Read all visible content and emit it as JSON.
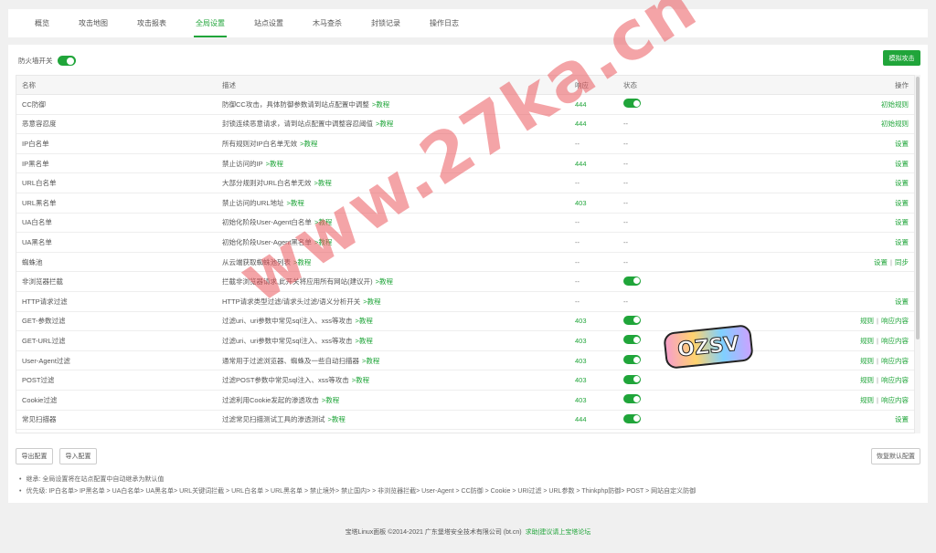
{
  "tabs": [
    "概览",
    "攻击地图",
    "攻击报表",
    "全局设置",
    "站点设置",
    "木马查杀",
    "封锁记录",
    "操作日志"
  ],
  "active_tab_index": 3,
  "firewall_switch": {
    "label": "防火墙开关",
    "on": true
  },
  "simulate_button": "模拟攻击",
  "table": {
    "headers": {
      "name": "名称",
      "desc": "描述",
      "resp": "响应",
      "status": "状态",
      "ops": "操作"
    },
    "rows": [
      {
        "name": "CC防御",
        "desc": "防御CC攻击，具体防御参数请到站点配置中调整",
        "tut": ">教程",
        "resp": "444",
        "status": "on",
        "ops": [
          "初始规则"
        ]
      },
      {
        "name": "恶意容忍度",
        "desc": "封锁连续恶意请求，请到站点配置中调整容忍阈值",
        "tut": ">教程",
        "resp": "444",
        "status": "--",
        "ops": [
          "初始规则"
        ]
      },
      {
        "name": "IP白名单",
        "desc": "所有规则对IP白名单无效",
        "tut": ">教程",
        "resp": "--",
        "status": "--",
        "ops": [
          "设置"
        ]
      },
      {
        "name": "IP黑名单",
        "desc": "禁止访问的IP",
        "tut": ">教程",
        "resp": "444",
        "status": "--",
        "ops": [
          "设置"
        ]
      },
      {
        "name": "URL白名单",
        "desc": "大部分规则对URL白名单无效",
        "tut": ">教程",
        "resp": "--",
        "status": "--",
        "ops": [
          "设置"
        ]
      },
      {
        "name": "URL黑名单",
        "desc": "禁止访问的URL地址",
        "tut": ">教程",
        "resp": "403",
        "status": "--",
        "ops": [
          "设置"
        ]
      },
      {
        "name": "UA白名单",
        "desc": "初始化阶段User-Agent白名单",
        "tut": ">教程",
        "resp": "--",
        "status": "--",
        "ops": [
          "设置"
        ]
      },
      {
        "name": "UA黑名单",
        "desc": "初始化阶段User-Agent黑名单",
        "tut": ">教程",
        "resp": "--",
        "status": "--",
        "ops": [
          "设置"
        ]
      },
      {
        "name": "蜘蛛池",
        "desc": "从云端获取蜘蛛池列表",
        "tut": ">教程",
        "resp": "--",
        "status": "--",
        "ops": [
          "设置",
          "同步"
        ]
      },
      {
        "name": "非浏览器拦截",
        "desc": "拦截非浏览器请求,此开关将应用所有网站(建议开)",
        "tut": ">教程",
        "resp": "--",
        "status": "on",
        "ops": []
      },
      {
        "name": "HTTP请求过滤",
        "desc": "HTTP请求类型过滤/请求头过滤/语义分析开关",
        "tut": ">教程",
        "resp": "--",
        "status": "--",
        "ops": [
          "设置"
        ]
      },
      {
        "name": "GET-参数过滤",
        "desc": "过滤uri、uri参数中常见sql注入、xss等攻击",
        "tut": ">教程",
        "resp": "403",
        "status": "on",
        "ops": [
          "规则",
          "响应内容"
        ]
      },
      {
        "name": "GET-URL过滤",
        "desc": "过滤uri、uri参数中常见sql注入、xss等攻击",
        "tut": ">教程",
        "resp": "403",
        "status": "on",
        "ops": [
          "规则",
          "响应内容"
        ]
      },
      {
        "name": "User-Agent过滤",
        "desc": "通常用于过滤浏览器、蜘蛛及一些自动扫描器",
        "tut": ">教程",
        "resp": "403",
        "status": "on",
        "ops": [
          "规则",
          "响应内容"
        ]
      },
      {
        "name": "POST过滤",
        "desc": "过滤POST参数中常见sql注入、xss等攻击",
        "tut": ">教程",
        "resp": "403",
        "status": "on",
        "ops": [
          "规则",
          "响应内容"
        ]
      },
      {
        "name": "Cookie过滤",
        "desc": "过滤利用Cookie发起的渗透攻击",
        "tut": ">教程",
        "resp": "403",
        "status": "on",
        "ops": [
          "规则",
          "响应内容"
        ]
      },
      {
        "name": "常见扫描器",
        "desc": "过滤常见扫描测试工具的渗透测试",
        "tut": ">教程",
        "resp": "444",
        "status": "on",
        "ops": [
          "设置"
        ]
      }
    ]
  },
  "buttons": {
    "export": "导出配置",
    "import": "导入配置",
    "restore": "恢复默认配置"
  },
  "notes": [
    "继承: 全局设置将在站点配置中自动继承为默认值",
    "优先级: IP白名单> IP黑名单 > UA白名单> UA黑名单> URL关键词拦截 > URL白名单 > URL黑名单 > 禁止境外> 禁止国内> > 非浏览器拦截> User-Agent > CC防御 > Cookie > URI过滤 > URL参数 > Thinkphp防御> POST > 网站自定义防御"
  ],
  "footer": {
    "text": "宝塔Linux面板 ©2014-2021 广东堡塔安全技术有限公司 (bt.cn)",
    "link": "求助|建议请上宝塔论坛"
  },
  "watermark": "www.27ka.cn",
  "sticker": "OZSV"
}
